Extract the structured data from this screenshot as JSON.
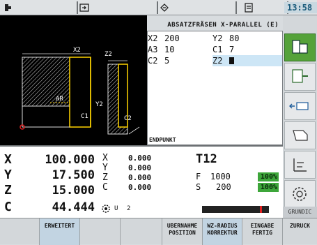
{
  "header": {
    "time": "13:58",
    "tabs": [
      "machine-tab",
      "program-tab",
      "offset-tab",
      "editor-tab"
    ]
  },
  "cycle": {
    "title": "ABSATZFRÄSEN X-PARALLEL (E)",
    "params": [
      {
        "name": "X2",
        "value": "200"
      },
      {
        "name": "Y2",
        "value": "80"
      },
      {
        "name": "A3",
        "value": "10"
      },
      {
        "name": "C1",
        "value": "7"
      },
      {
        "name": "C2",
        "value": "5"
      },
      {
        "name": "Z2",
        "value": ""
      }
    ],
    "footer_label": "ENDPUNKT",
    "graphic_labels": {
      "x2": "X2",
      "z2": "Z2",
      "a": "AR",
      "c1": "C1",
      "y2": "Y2",
      "c2": "C2"
    }
  },
  "positions": [
    {
      "axis": "X",
      "value": "100.000"
    },
    {
      "axis": "Y",
      "value": "17.500"
    },
    {
      "axis": "Z",
      "value": "15.000"
    },
    {
      "axis": "C",
      "value": "44.444"
    }
  ],
  "distance": [
    {
      "axis": "X",
      "value": "0.000"
    },
    {
      "axis": "Y",
      "value": "0.000"
    },
    {
      "axis": "Z",
      "value": "0.000"
    },
    {
      "axis": "C",
      "value": "0.000"
    }
  ],
  "tool": {
    "label": "T",
    "number": "12"
  },
  "feed": {
    "label": "F",
    "value": "1000",
    "override": "100%"
  },
  "spindle": {
    "label": "S",
    "value": "200",
    "override": "100%",
    "load": 0.9
  },
  "gear": {
    "value": "2"
  },
  "softkeys_bottom": [
    {
      "line1": "",
      "line2": ""
    },
    {
      "line1": "ERWEITERT",
      "line2": ""
    },
    {
      "line1": "",
      "line2": ""
    },
    {
      "line1": "",
      "line2": ""
    },
    {
      "line1": "UBERNAHME",
      "line2": "POSITION"
    },
    {
      "line1": "WZ-RADIUS",
      "line2": "KORREKTUR"
    },
    {
      "line1": "EINGABE",
      "line2": "FERTIG"
    },
    {
      "line1": "ZURUCK",
      "line2": ""
    }
  ],
  "softkeys_right": {
    "grund": "GRUNDIC"
  },
  "colors": {
    "active_green": "#55a23a",
    "override_green": "#3da63a",
    "graphic_yellow": "#ffd400",
    "load_red": "#e02020"
  }
}
